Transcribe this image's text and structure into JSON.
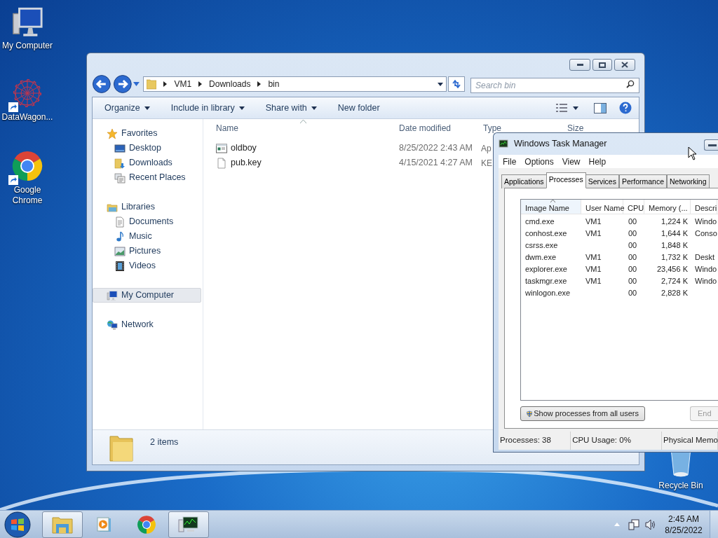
{
  "desktop_icons": [
    {
      "kind": "computer",
      "label": "My Computer"
    },
    {
      "kind": "app",
      "label": "DataWagon..."
    },
    {
      "kind": "chrome",
      "label": "Google Chrome"
    },
    {
      "kind": "recycle",
      "label": "Recycle Bin"
    }
  ],
  "explorer": {
    "breadcrumb": [
      "VM1",
      "Downloads",
      "bin"
    ],
    "search_placeholder": "Search bin",
    "toolbar": [
      {
        "label": "Organize",
        "dropdown": true
      },
      {
        "label": "Include in library",
        "dropdown": true
      },
      {
        "label": "Share with",
        "dropdown": true
      },
      {
        "label": "New folder",
        "dropdown": false
      }
    ],
    "nav": [
      {
        "label": "Favorites",
        "kind": "star",
        "selected": false,
        "children": [
          {
            "label": "Desktop",
            "kind": "desktop",
            "selected": false
          },
          {
            "label": "Downloads",
            "kind": "downloads",
            "selected": false
          },
          {
            "label": "Recent Places",
            "kind": "recent",
            "selected": false
          }
        ]
      },
      {
        "label": "Libraries",
        "kind": "library",
        "selected": false,
        "children": [
          {
            "label": "Documents",
            "kind": "document",
            "selected": false
          },
          {
            "label": "Music",
            "kind": "music",
            "selected": false
          },
          {
            "label": "Pictures",
            "kind": "pictures",
            "selected": false
          },
          {
            "label": "Videos",
            "kind": "videos",
            "selected": false
          }
        ]
      },
      {
        "label": "My Computer",
        "kind": "computer",
        "selected": true
      },
      {
        "label": "Network",
        "kind": "network",
        "selected": false
      }
    ],
    "columns": [
      "Name",
      "Date modified",
      "Type",
      "Size"
    ],
    "files": [
      {
        "name": "oldboy",
        "kind": "exe",
        "date": "8/25/2022 2:43 AM",
        "type": "Ap"
      },
      {
        "name": "pub.key",
        "kind": "file",
        "date": "4/15/2021 4:27 AM",
        "type": "KE"
      }
    ],
    "status": "2 items"
  },
  "task_manager": {
    "title": "Windows Task Manager",
    "menu": [
      "File",
      "Options",
      "View",
      "Help"
    ],
    "tabs": [
      {
        "label": "Applications",
        "selected": false
      },
      {
        "label": "Processes",
        "selected": true
      },
      {
        "label": "Services",
        "selected": false
      },
      {
        "label": "Performance",
        "selected": false
      },
      {
        "label": "Networking",
        "selected": false
      }
    ],
    "columns": [
      "Image Name",
      "User Name",
      "CPU",
      "Memory (...",
      "Descri"
    ],
    "rows": [
      {
        "image": "cmd.exe",
        "user": "VM1",
        "cpu": "00",
        "memory": "1,224 K",
        "description": "Windo"
      },
      {
        "image": "conhost.exe",
        "user": "VM1",
        "cpu": "00",
        "memory": "1,644 K",
        "description": "Conso"
      },
      {
        "image": "csrss.exe",
        "cpu": "00",
        "memory": "1,848 K"
      },
      {
        "image": "dwm.exe",
        "user": "VM1",
        "cpu": "00",
        "memory": "1,732 K",
        "description": "Deskt"
      },
      {
        "image": "explorer.exe",
        "user": "VM1",
        "cpu": "00",
        "memory": "23,456 K",
        "description": "Windo"
      },
      {
        "image": "taskmgr.exe",
        "user": "VM1",
        "cpu": "00",
        "memory": "2,724 K",
        "description": "Windo"
      },
      {
        "image": "winlogon.exe",
        "cpu": "00",
        "memory": "2,828 K"
      }
    ],
    "show_all_button": "Show processes from all users",
    "end_button": {
      "label": "End",
      "disabled": true
    },
    "status": [
      "Processes: 38",
      "CPU Usage: 0%",
      "Physical Memo"
    ]
  },
  "taskbar": {
    "apps": [
      {
        "kind": "explorer",
        "active": true
      },
      {
        "kind": "media",
        "active": false
      },
      {
        "kind": "chrome",
        "active": false
      },
      {
        "kind": "taskmgr",
        "active": true
      }
    ],
    "time": "2:45 AM",
    "date": "8/25/2022"
  }
}
